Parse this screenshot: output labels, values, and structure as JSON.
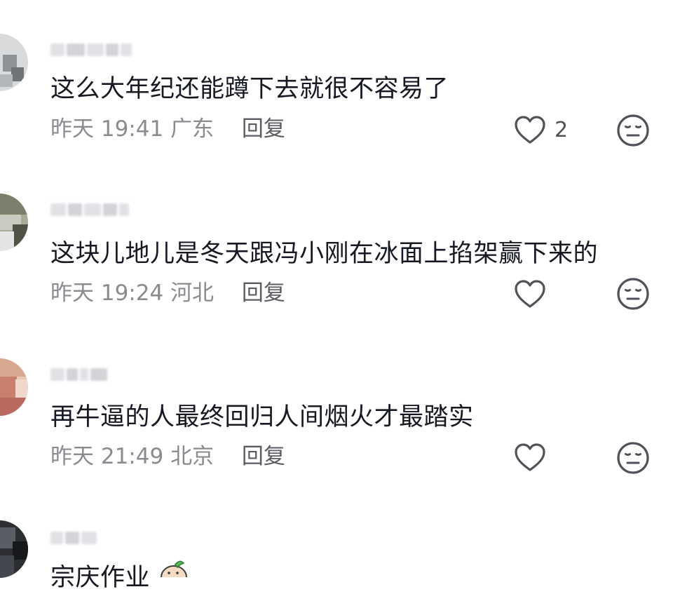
{
  "comments": [
    {
      "text": "这么大年纪还能蹲下去就很不容易了",
      "date": "昨天",
      "time": "19:41",
      "location": "广东",
      "reply_label": "回复",
      "like_count": "2",
      "like_icon": "heart-outline-icon",
      "dislike_icon": "neutral-face-icon"
    },
    {
      "text": "这块儿地儿是冬天跟冯小刚在冰面上掐架赢下来的",
      "date": "昨天",
      "time": "19:24",
      "location": "河北",
      "reply_label": "回复",
      "like_count": "",
      "like_icon": "heart-outline-icon",
      "dislike_icon": "neutral-face-icon"
    },
    {
      "text": "再牛逼的人最终回归人间烟火才最踏实",
      "date": "昨天",
      "time": "21:49",
      "location": "北京",
      "reply_label": "回复",
      "like_count": "",
      "like_icon": "heart-outline-icon",
      "dislike_icon": "neutral-face-icon"
    },
    {
      "text": "宗庆作业",
      "sticker_icon": "emoji-sticker-icon"
    }
  ],
  "colors": {
    "text": "#161823",
    "meta": "#8a8b91",
    "icon": "#505159"
  }
}
